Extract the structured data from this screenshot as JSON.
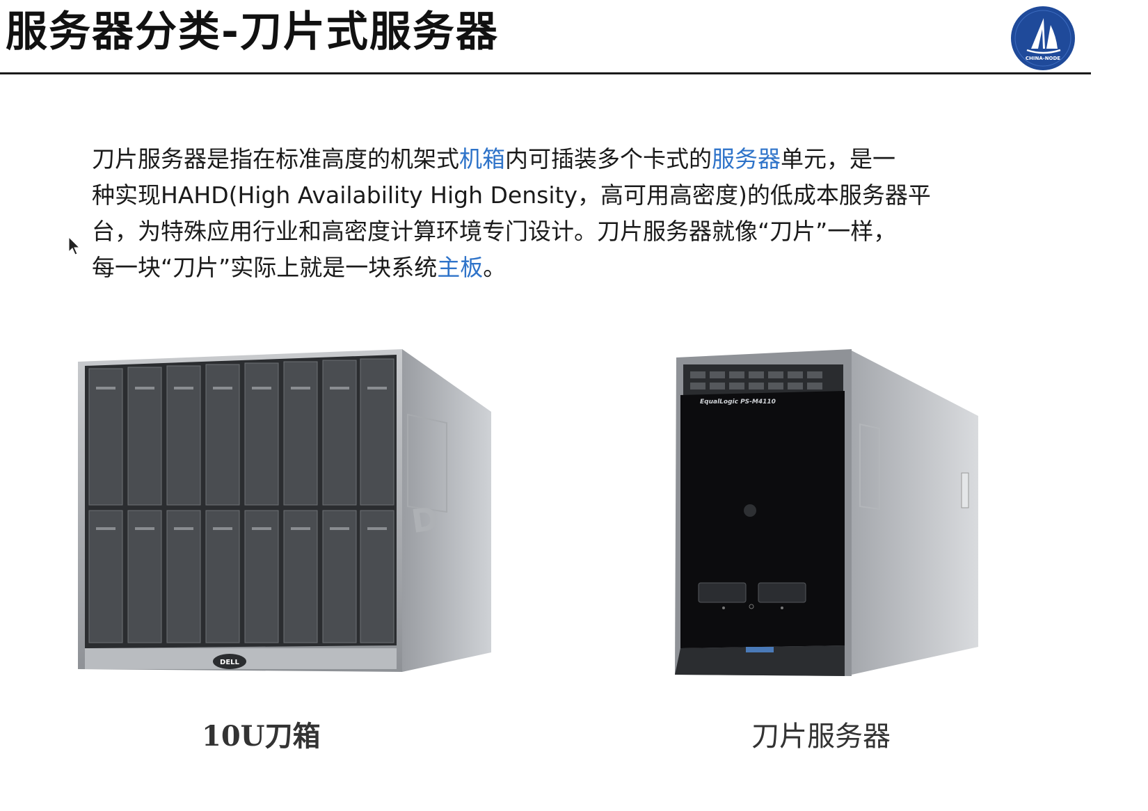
{
  "slide": {
    "title": "服务器分类-刀片式服务器",
    "logo_text": "CHINA-NODE"
  },
  "paragraph": {
    "line1_a": "刀片服务器是指在标准高度的机架式",
    "line1_link1": "机箱",
    "line1_b": "内可插装多个卡式的",
    "line1_link2": "服务器",
    "line1_c": "单元，是一",
    "line2": "种实现HAHD(High Availability High Density，高可用高密度)的低成本服务器平",
    "line3": "台，为特殊应用行业和高密度计算环境专门设计。刀片服务器就像“刀片”一样，",
    "line4_a": "每一块“刀片”实际上就是一块系统",
    "line4_link": "主板",
    "line4_b": "。"
  },
  "figures": {
    "left": {
      "caption": "10U刀箱",
      "brand": "DELL"
    },
    "right": {
      "caption": "刀片服务器",
      "label": "EqualLogic PS-M4110"
    }
  },
  "colors": {
    "link": "#2e73c9",
    "logo_bg": "#1f4a9a",
    "rule": "#1a1a1a"
  }
}
